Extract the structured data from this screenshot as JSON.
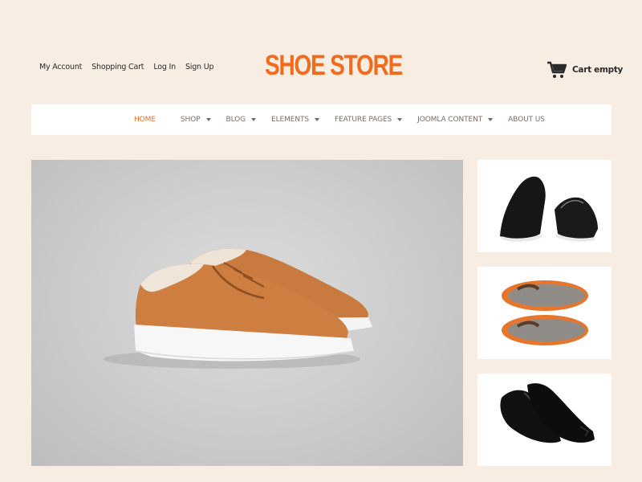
{
  "top_links": [
    "My Account",
    "Shopping Cart",
    "Log In",
    "Sign Up"
  ],
  "logo": "SHOE STORE",
  "cart": {
    "label": "Cart empty",
    "icon": "cart-icon"
  },
  "nav": [
    {
      "label": "HOME",
      "active": true,
      "has_dropdown": false
    },
    {
      "label": "SHOP",
      "active": false,
      "has_dropdown": true
    },
    {
      "label": "BLOG",
      "active": false,
      "has_dropdown": true
    },
    {
      "label": "ELEMENTS",
      "active": false,
      "has_dropdown": true
    },
    {
      "label": "FEATURE PAGES",
      "active": false,
      "has_dropdown": true
    },
    {
      "label": "JOOMLA CONTENT",
      "active": false,
      "has_dropdown": true
    },
    {
      "label": "ABOUT US",
      "active": false,
      "has_dropdown": false
    }
  ],
  "colors": {
    "accent": "#f26b1d",
    "background": "#f8ede3",
    "nav_bg": "#ffffff"
  }
}
